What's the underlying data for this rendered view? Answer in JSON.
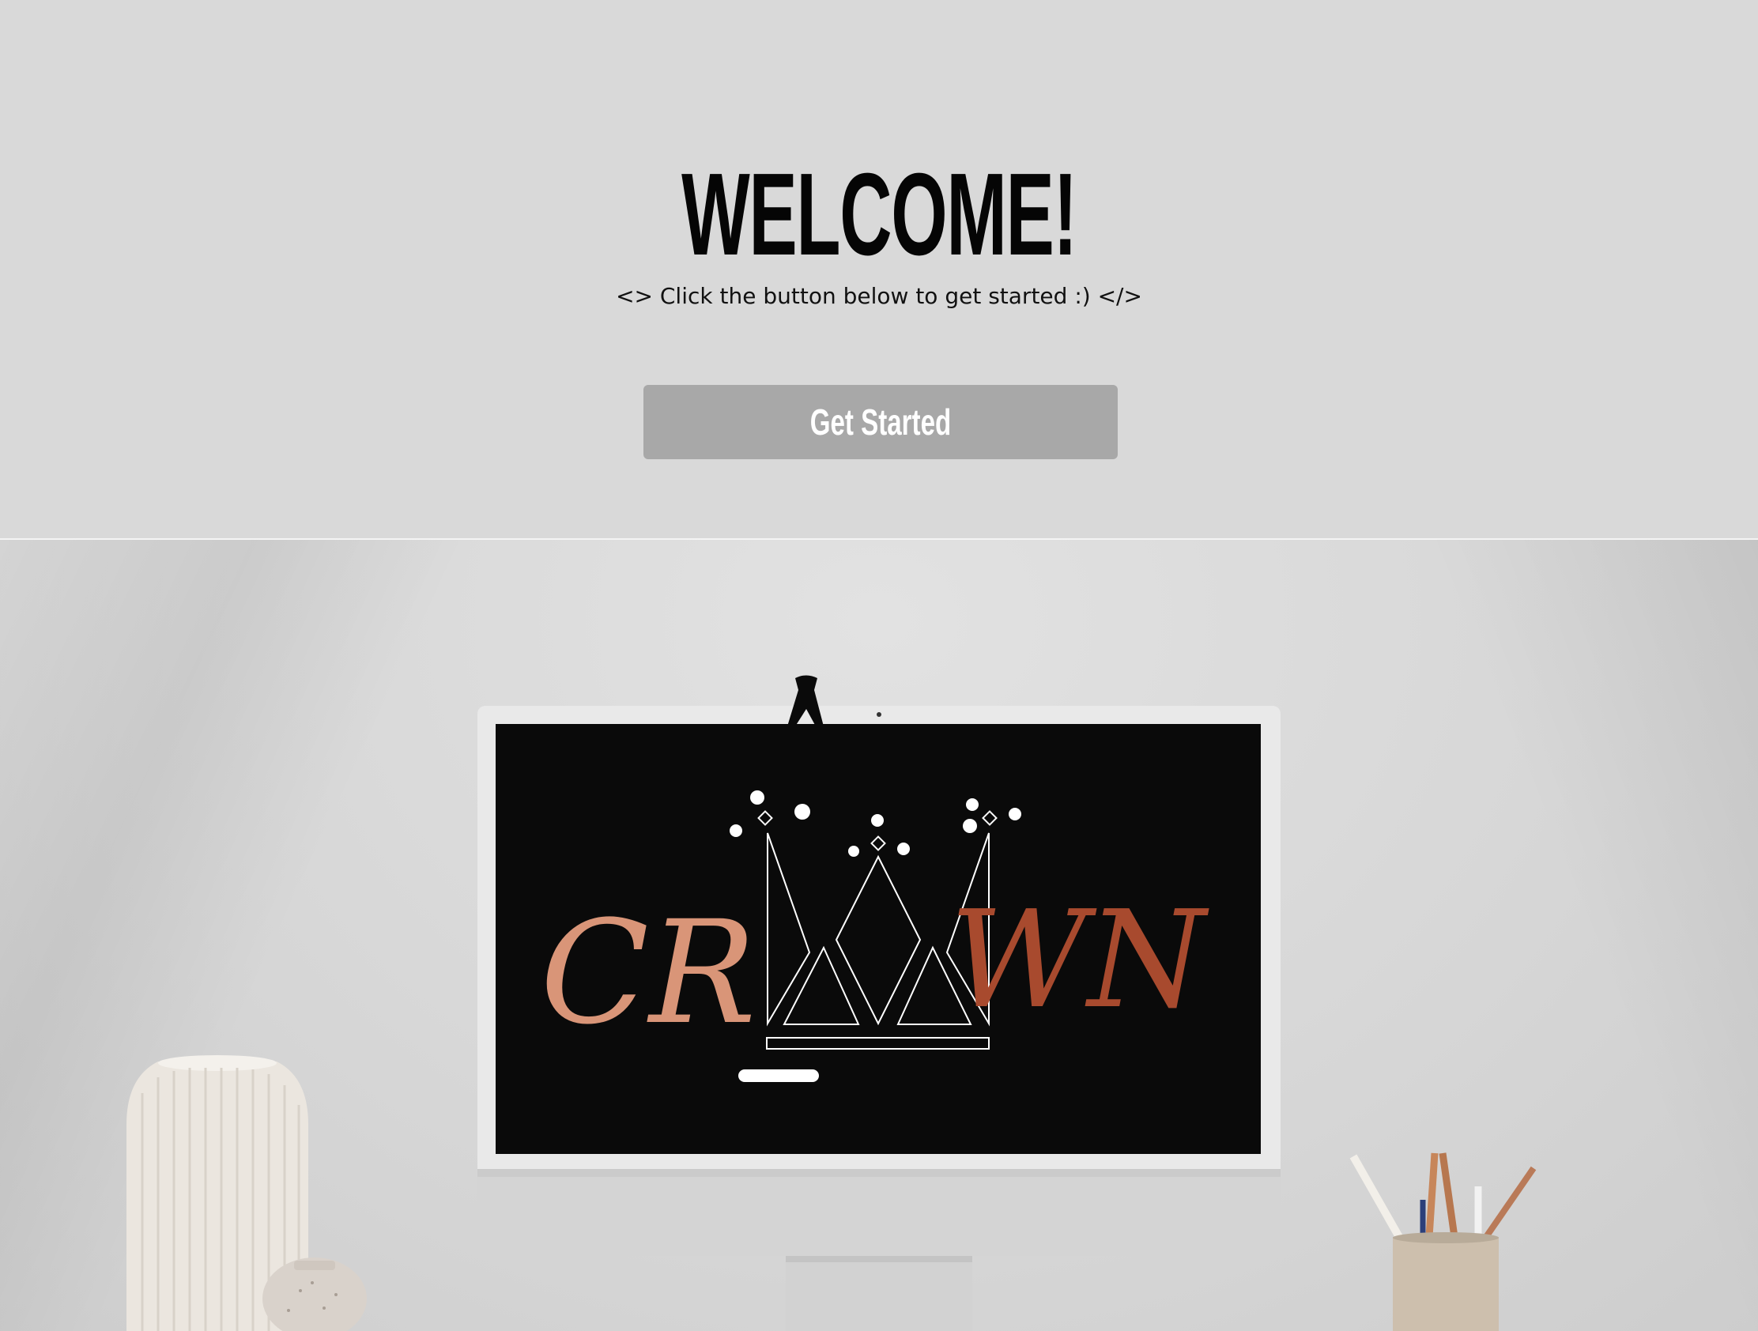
{
  "hero": {
    "title": "WELCOME!",
    "subtitle": "<> Click the button below to get started :) </>",
    "cta_label": "Get Started"
  },
  "artwork": {
    "screen_text_left": "CR",
    "screen_text_right": "WN"
  },
  "colors": {
    "hero_bg": "#d9d9d9",
    "button_bg": "#a8a8a8",
    "button_text": "#ffffff",
    "screen_bg": "#0a0a0a",
    "letter_left": "#d99578",
    "letter_right": "#a84a2e"
  }
}
